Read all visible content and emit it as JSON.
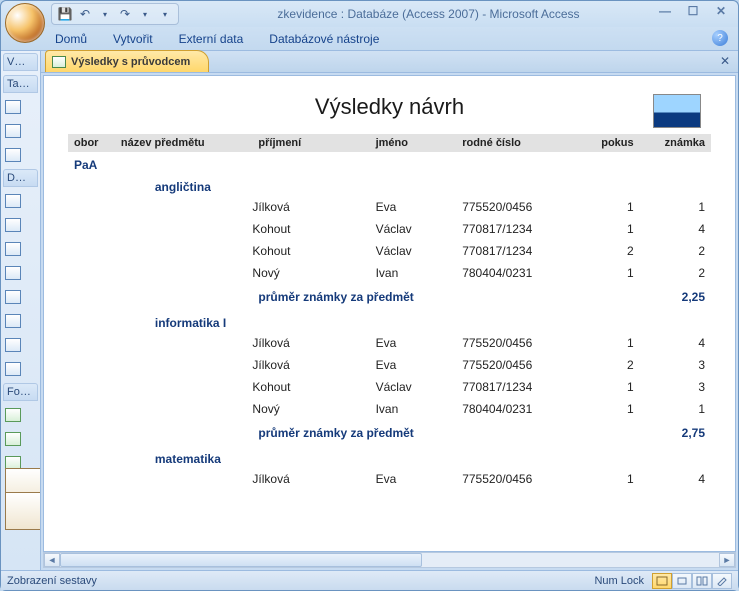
{
  "window": {
    "title": "zkevidence : Databáze (Access 2007) - Microsoft Access"
  },
  "ribbon": {
    "tabs": [
      "Domů",
      "Vytvořit",
      "Externí data",
      "Databázové nástroje"
    ]
  },
  "navpane": {
    "sections": [
      {
        "label": "V…"
      },
      {
        "label": "Ta…"
      },
      {
        "label": "D…"
      },
      {
        "label": "Fo…"
      }
    ]
  },
  "document": {
    "tab_label": "Výsledky s průvodcem"
  },
  "report": {
    "title": "Výsledky návrh",
    "columns": {
      "obor": "obor",
      "nazev": "název předmětu",
      "prijmeni": "příjmení",
      "jmeno": "jméno",
      "rc": "rodné číslo",
      "pokus": "pokus",
      "znamka": "známka"
    },
    "avg_label": "průměr známky za předmět",
    "groups": [
      {
        "obor": "PaA",
        "subjects": [
          {
            "name": "angličtina",
            "rows": [
              {
                "surname": "Jílková",
                "first": "Eva",
                "rc": "775520/0456",
                "attempt": "1",
                "grade": "1"
              },
              {
                "surname": "Kohout",
                "first": "Václav",
                "rc": "770817/1234",
                "attempt": "1",
                "grade": "4"
              },
              {
                "surname": "Kohout",
                "first": "Václav",
                "rc": "770817/1234",
                "attempt": "2",
                "grade": "2"
              },
              {
                "surname": "Nový",
                "first": "Ivan",
                "rc": "780404/0231",
                "attempt": "1",
                "grade": "2"
              }
            ],
            "avg": "2,25"
          },
          {
            "name": "informatika I",
            "rows": [
              {
                "surname": "Jílková",
                "first": "Eva",
                "rc": "775520/0456",
                "attempt": "1",
                "grade": "4"
              },
              {
                "surname": "Jílková",
                "first": "Eva",
                "rc": "775520/0456",
                "attempt": "2",
                "grade": "3"
              },
              {
                "surname": "Kohout",
                "first": "Václav",
                "rc": "770817/1234",
                "attempt": "1",
                "grade": "3"
              },
              {
                "surname": "Nový",
                "first": "Ivan",
                "rc": "780404/0231",
                "attempt": "1",
                "grade": "1"
              }
            ],
            "avg": "2,75"
          },
          {
            "name": "matematika",
            "rows": [
              {
                "surname": "Jílková",
                "first": "Eva",
                "rc": "775520/0456",
                "attempt": "1",
                "grade": "4"
              }
            ],
            "avg": ""
          }
        ]
      }
    ]
  },
  "statusbar": {
    "view_state": "Zobrazení sestavy",
    "numlock": "Num Lock"
  }
}
